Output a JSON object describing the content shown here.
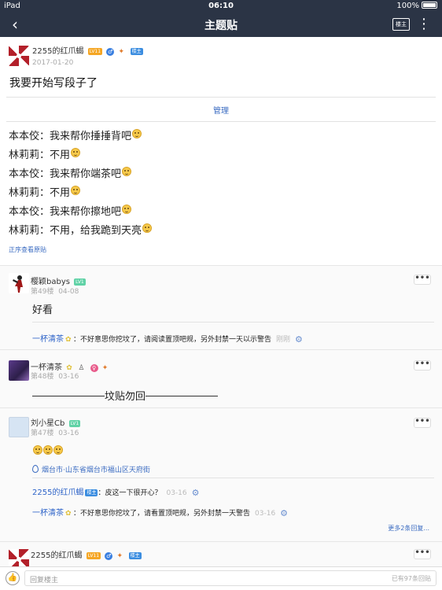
{
  "statusbar": {
    "carrier": "iPad",
    "time": "06:10",
    "battery": "100%"
  },
  "navbar": {
    "back": "‹",
    "title": "主题贴",
    "louzhu_button": "楼主",
    "more": "⋮"
  },
  "post": {
    "author": "2255的红爪蝎",
    "level": "LV11",
    "louzhu_badge": "楼主",
    "date": "2017-01-20",
    "title": "我要开始写段子了",
    "manage_label": "管理",
    "lines": [
      "本本佼：我来帮你捶捶背吧",
      "林莉莉：不用",
      "本本佼：我来帮你端茶吧",
      "林莉莉：不用",
      "本本佼：我来帮你擦地吧",
      "林莉莉：不用，给我跪到天亮"
    ],
    "order_link": "正序查看原贴"
  },
  "replies": [
    {
      "author": "樱颖babys",
      "level": "LV1",
      "floor": "第49楼",
      "date": "04-08",
      "content": "好看",
      "sub": [
        {
          "user": "一杯清茶",
          "text": "：不好意思你挖坟了，请阅读置顶吧规，另外封禁一天以示警告",
          "time": "刚刚"
        }
      ]
    },
    {
      "author": "一杯清茶",
      "floor": "第48楼",
      "date": "03-16",
      "content": "坟贴勿回"
    },
    {
      "author": "刘小星Cb",
      "level": "LV1",
      "floor": "第47楼",
      "date": "03-16",
      "location": "烟台市·山东省烟台市福山区天府街",
      "sub": [
        {
          "user": "2255的红爪蝎",
          "badge": "楼主",
          "text": "：皮这一下很开心？",
          "time": "03-16"
        },
        {
          "user": "一杯清茶",
          "text": "：不好意思你挖坟了，请看置顶吧规，另外封禁一天警告",
          "time": "03-16"
        }
      ],
      "more": "更多2条回复..."
    },
    {
      "author": "2255的红爪蝎",
      "level": "LV11",
      "louzhu_badge": "楼主"
    }
  ],
  "bottombar": {
    "placeholder": "回复楼主",
    "count": "已有97条回贴"
  },
  "colors": {
    "navbar": "#2b3445",
    "link": "#3a6bc1"
  }
}
